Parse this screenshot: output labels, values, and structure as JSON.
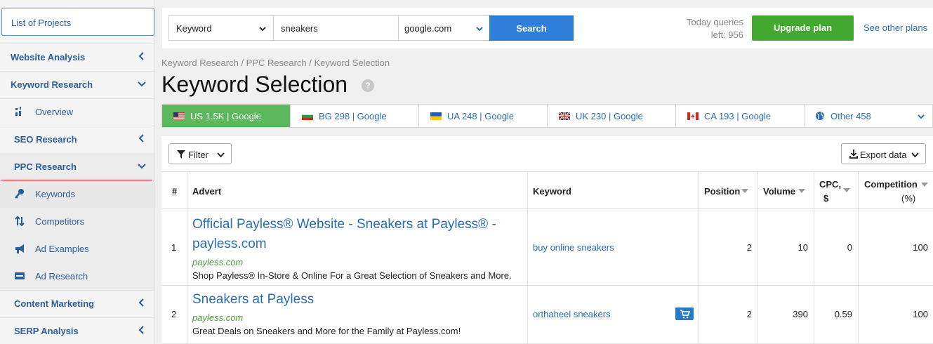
{
  "sidebar": {
    "projects_label": "List of Projects",
    "sections": [
      {
        "label": "Website Analysis"
      },
      {
        "label": "Keyword Research"
      }
    ],
    "overview": "Overview",
    "seo_research": "SEO Research",
    "ppc_research": "PPC Research",
    "ppc_items": [
      "Keywords",
      "Competitors",
      "Ad Examples",
      "Ad Research"
    ],
    "content_marketing": "Content Marketing",
    "serp_analysis": "SERP Analysis"
  },
  "topbar": {
    "search_type": "Keyword",
    "query": "sneakers",
    "engine": "google.com",
    "search_label": "Search",
    "queries_line1": "Today queries",
    "queries_line2": "left: 956",
    "upgrade_label": "Upgrade plan",
    "other_plans_label": "See other plans"
  },
  "breadcrumb": "Keyword Research / PPC Research / Keyword Selection",
  "page_title": "Keyword Selection",
  "help_glyph": "?",
  "db_tabs": [
    {
      "label": "US 1.5K | Google",
      "flag": "us",
      "active": true
    },
    {
      "label": "BG 298 | Google",
      "flag": "bg",
      "active": false
    },
    {
      "label": "UA 248 | Google",
      "flag": "ua",
      "active": false
    },
    {
      "label": "UK 230 | Google",
      "flag": "uk",
      "active": false
    },
    {
      "label": "CA 193 | Google",
      "flag": "ca",
      "active": false
    },
    {
      "label": "Other 458",
      "flag": "globe",
      "active": false
    }
  ],
  "toolbar": {
    "filter_label": "Filter",
    "export_label": "Export data"
  },
  "table": {
    "headers": {
      "num": "#",
      "advert": "Advert",
      "keyword": "Keyword",
      "position": "Position",
      "volume": "Volume",
      "cpc_line1": "CPC,",
      "cpc_line2": "$",
      "competition_line1": "Competition",
      "competition_line2": "(%)"
    },
    "rows": [
      {
        "num": "1",
        "title_line1": "Official Payless® Website - Sneakers at Payless® -",
        "title_line2": "payless.com",
        "url": "payless.com",
        "description": "Shop Payless® In-Store & Online For a Great Selection of Sneakers and More.",
        "keyword": "buy online sneakers",
        "position": "2",
        "volume": "10",
        "cpc": "0",
        "competition": "100"
      },
      {
        "num": "2",
        "title_line1": "Sneakers at Payless",
        "url": "payless.com",
        "description": "Great Deals on Sneakers and More for the Family at Payless.com!",
        "keyword": "orthaheel sneakers",
        "position": "2",
        "volume": "390",
        "cpc": "0.59",
        "competition": "100"
      }
    ]
  },
  "colors": {
    "accent_blue": "#2f7fd8",
    "link_blue": "#2a6eb5",
    "upgrade_green": "#43a82f",
    "active_tab_green": "#5cb85c",
    "highlight_red": "#e0161b"
  }
}
